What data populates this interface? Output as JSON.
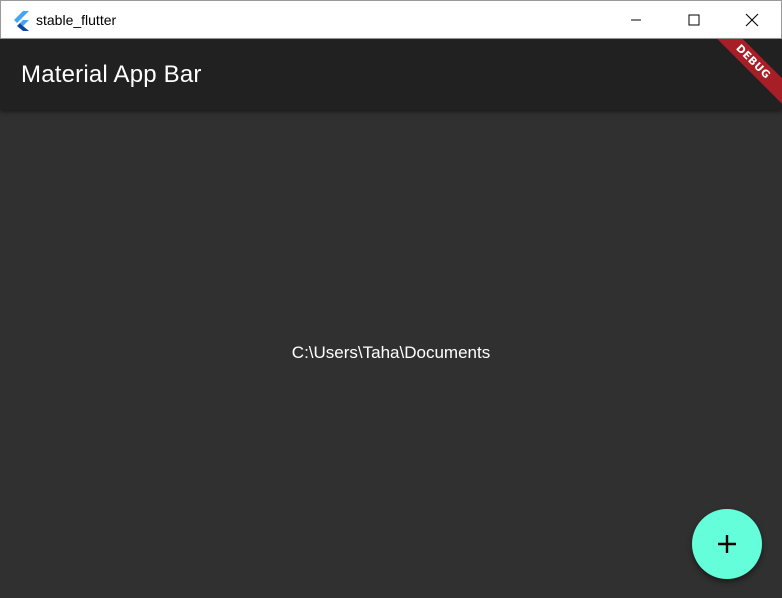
{
  "window": {
    "title": "stable_flutter",
    "controls": [
      "minimize-icon",
      "maximize-icon",
      "close-icon"
    ]
  },
  "appbar": {
    "title": "Material App Bar",
    "background": "#212121"
  },
  "debug_banner": {
    "label": "DEBUG",
    "color": "#a81e26"
  },
  "main": {
    "path_text": "C:\\Users\\Taha\\Documents",
    "background": "#303030"
  },
  "fab": {
    "icon": "plus-icon",
    "color": "#64ffda"
  },
  "app_icon": "flutter-logo-icon"
}
